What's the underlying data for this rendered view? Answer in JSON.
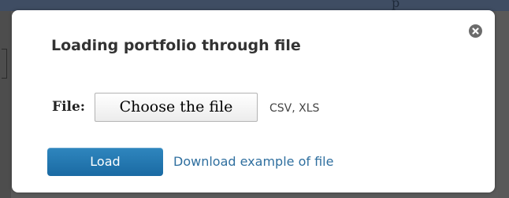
{
  "backdrop": {
    "fragment_text": "p"
  },
  "dialog": {
    "title": "Loading portfolio through file",
    "close_icon": "close-icon",
    "file": {
      "label": "File:",
      "button_label": "Choose the file",
      "hint": "CSV, XLS"
    },
    "actions": {
      "load_label": "Load",
      "download_link": "Download example of file"
    }
  },
  "colors": {
    "primary_button": "#1f72ad",
    "link": "#2f6f9f",
    "close_icon": "#6b6b6b"
  }
}
